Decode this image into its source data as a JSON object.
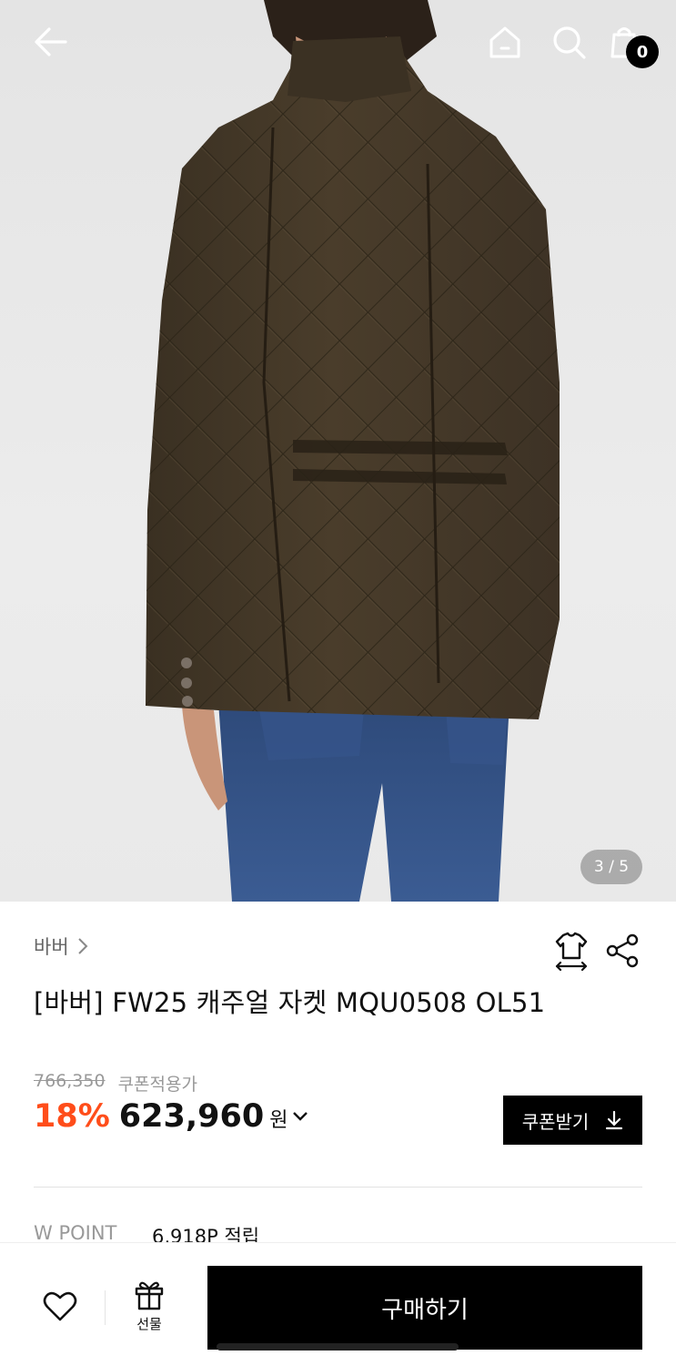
{
  "header": {
    "back_icon": "arrow-left-icon",
    "home_icon": "home-icon",
    "search_icon": "search-icon",
    "bag_icon": "shopping-bag-icon",
    "cart_count": "0"
  },
  "gallery": {
    "counter": "3 / 5",
    "current": 3,
    "total": 5
  },
  "product": {
    "brand": "바버",
    "title": "[바버] FW25 캐주얼 자켓 MQU0508 OL51",
    "original_price": "766,350",
    "coupon_note": "쿠폰적용가",
    "discount": "18%",
    "price": "623,960",
    "currency": "원",
    "coupon_button": "쿠폰받기"
  },
  "points": {
    "label": "W POINT",
    "value": "6,918P 적립"
  },
  "bottom_bar": {
    "gift_label": "선물",
    "buy_label": "구매하기"
  },
  "colors": {
    "discount": "#ff4d1a",
    "primary_button": "#000000"
  }
}
